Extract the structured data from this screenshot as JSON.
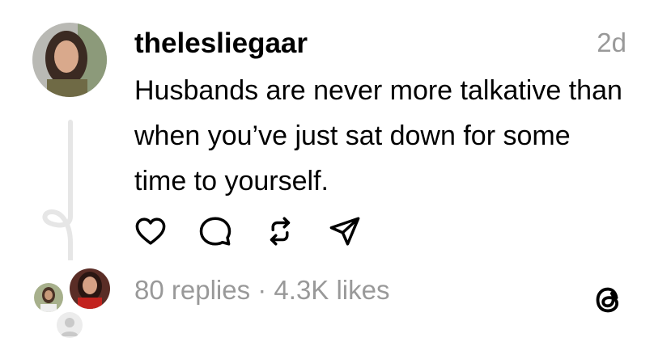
{
  "post": {
    "username": "thelesliegaar",
    "time": "2d",
    "text": "Husbands are never more talkative than when you’ve just sat down for some time to yourself."
  },
  "stats": {
    "replies": "80 replies",
    "separator": " · ",
    "likes": "4.3K likes"
  },
  "icons": {
    "like": "heart-icon",
    "reply": "comment-bubble-icon",
    "repost": "repost-icon",
    "share": "send-icon",
    "brand": "threads-logo-icon"
  },
  "colors": {
    "muted_text": "#999999",
    "thread_line": "#e6e6e6"
  }
}
